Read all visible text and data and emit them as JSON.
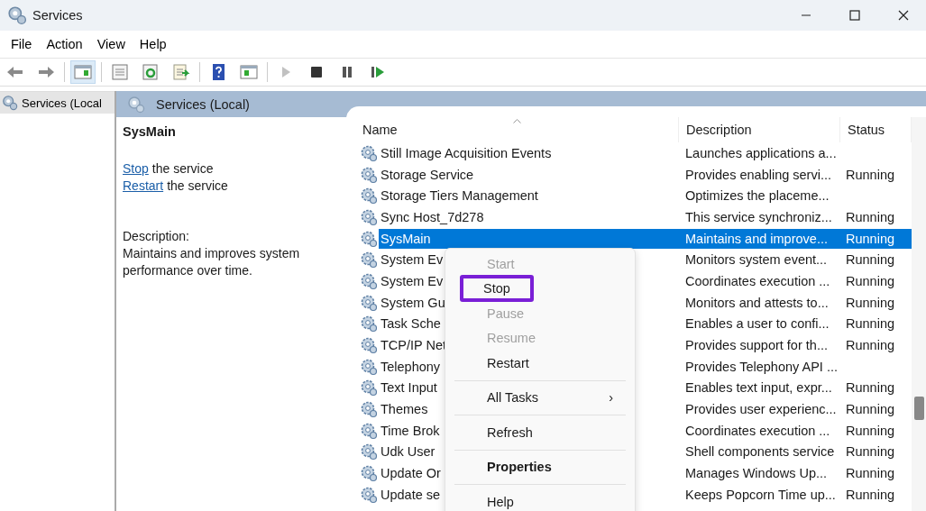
{
  "window": {
    "title": "Services"
  },
  "menu_bar": [
    "File",
    "Action",
    "View",
    "Help"
  ],
  "toolbar": [
    {
      "kind": "back",
      "selected": false,
      "disabled": false
    },
    {
      "kind": "forward",
      "selected": false,
      "disabled": false
    },
    {
      "kind": "separator"
    },
    {
      "kind": "tree",
      "selected": true,
      "disabled": false
    },
    {
      "kind": "separator"
    },
    {
      "kind": "properties",
      "selected": false,
      "disabled": false
    },
    {
      "kind": "refresh",
      "selected": false,
      "disabled": false
    },
    {
      "kind": "export",
      "selected": false,
      "disabled": false
    },
    {
      "kind": "separator"
    },
    {
      "kind": "help",
      "selected": false,
      "disabled": false
    },
    {
      "kind": "action-pane",
      "selected": false,
      "disabled": false
    },
    {
      "kind": "separator"
    },
    {
      "kind": "play",
      "selected": false,
      "disabled": true
    },
    {
      "kind": "stop",
      "selected": false,
      "disabled": false
    },
    {
      "kind": "pause",
      "selected": false,
      "disabled": false
    },
    {
      "kind": "resume",
      "selected": false,
      "disabled": false
    }
  ],
  "tree": {
    "items": [
      {
        "label": "Services (Local",
        "selected": true
      }
    ]
  },
  "panel": {
    "title": "Services (Local)",
    "details": {
      "name": "SysMain",
      "actions": [
        {
          "link": "Stop",
          "text": "the service"
        },
        {
          "link": "Restart",
          "text": "the service"
        }
      ],
      "description_label": "Description:",
      "description": "Maintains and improves system performance over time."
    }
  },
  "table": {
    "columns": [
      "Name",
      "Description",
      "Status"
    ],
    "rows": [
      {
        "name": "Still Image Acquisition Events",
        "description": "Launches applications a...",
        "selected": false
      },
      {
        "name": "Storage Service",
        "description": "Provides enabling servi...",
        "status": "Running",
        "selected": false
      },
      {
        "name": "Storage Tiers Management",
        "description": "Optimizes the placeme...",
        "selected": false
      },
      {
        "name": "Sync Host_7d278",
        "description": "This service synchroniz...",
        "status": "Running",
        "selected": false
      },
      {
        "name": "SysMain",
        "description": "Maintains and improve...",
        "status": "Running",
        "selected": true
      },
      {
        "name": "System Ev",
        "description": "Monitors system event...",
        "status": "Running",
        "selected": false
      },
      {
        "name": "System Ev",
        "description": "Coordinates execution ...",
        "status": "Running",
        "selected": false
      },
      {
        "name": "System Gu",
        "description": "Monitors and attests to...",
        "status": "Running",
        "selected": false
      },
      {
        "name": "Task Sche",
        "description": "Enables a user to confi...",
        "status": "Running",
        "selected": false
      },
      {
        "name": "TCP/IP Net",
        "description": "Provides support for th...",
        "status": "Running",
        "selected": false
      },
      {
        "name": "Telephony",
        "description": "Provides Telephony API ...",
        "selected": false
      },
      {
        "name": "Text Input",
        "description": "Enables text input, expr...",
        "status": "Running",
        "selected": false
      },
      {
        "name": "Themes",
        "description": "Provides user experienc...",
        "status": "Running",
        "selected": false
      },
      {
        "name": "Time Brok",
        "description": "Coordinates execution ...",
        "status": "Running",
        "selected": false
      },
      {
        "name": "Udk User",
        "description": "Shell components service",
        "status": "Running",
        "selected": false
      },
      {
        "name": "Update Or",
        "description": "Manages Windows Up...",
        "status": "Running",
        "selected": false
      },
      {
        "name": "Update se",
        "description": "Keeps Popcorn Time up...",
        "status": "Running",
        "selected": false
      }
    ]
  },
  "context_menu": [
    {
      "kind": "item",
      "label": "Start",
      "disabled": true,
      "bold": false,
      "selected": false
    },
    {
      "kind": "item",
      "label": "Stop",
      "disabled": false,
      "bold": false,
      "selected": true
    },
    {
      "kind": "item",
      "label": "Pause",
      "disabled": true,
      "bold": false,
      "selected": false
    },
    {
      "kind": "item",
      "label": "Resume",
      "disabled": true,
      "bold": false,
      "selected": false
    },
    {
      "kind": "item",
      "label": "Restart",
      "disabled": false,
      "bold": false,
      "selected": false
    },
    {
      "kind": "separator"
    },
    {
      "kind": "item",
      "label": "All Tasks",
      "submenu": "›",
      "disabled": false,
      "bold": false,
      "selected": false
    },
    {
      "kind": "separator"
    },
    {
      "kind": "item",
      "label": "Refresh",
      "disabled": false,
      "bold": false,
      "selected": false
    },
    {
      "kind": "separator"
    },
    {
      "kind": "item",
      "label": "Properties",
      "disabled": false,
      "bold": true,
      "selected": false
    },
    {
      "kind": "separator"
    },
    {
      "kind": "item",
      "label": "Help",
      "disabled": false,
      "bold": false,
      "selected": false
    }
  ]
}
